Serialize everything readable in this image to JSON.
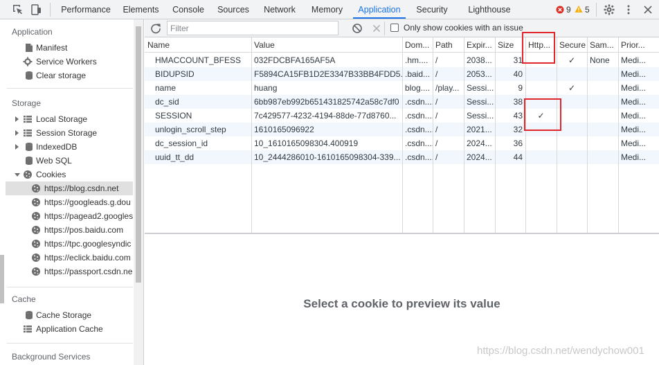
{
  "topbar": {
    "tabs": [
      {
        "label": "Performance",
        "active": false
      },
      {
        "label": "Elements",
        "active": false
      },
      {
        "label": "Console",
        "active": false
      },
      {
        "label": "Sources",
        "active": false
      },
      {
        "label": "Network",
        "active": false
      },
      {
        "label": "Memory",
        "active": false
      },
      {
        "label": "Application",
        "active": true
      },
      {
        "label": "Security",
        "active": false
      },
      {
        "label": "Lighthouse",
        "active": false
      }
    ],
    "error_count": "9",
    "warning_count": "5",
    "icons": [
      "inspect-icon",
      "device-toggle-icon",
      "error-icon",
      "warning-icon",
      "settings-gear-icon",
      "more-vertical-icon",
      "close-icon"
    ]
  },
  "sidebar": {
    "application": {
      "title": "Application",
      "items": [
        {
          "label": "Manifest",
          "icon": "manifest-icon"
        },
        {
          "label": "Service Workers",
          "icon": "gear-icon"
        },
        {
          "label": "Clear storage",
          "icon": "database-icon"
        }
      ]
    },
    "storage": {
      "title": "Storage",
      "items": [
        {
          "label": "Local Storage",
          "icon": "grid-icon",
          "expander": "collapsed"
        },
        {
          "label": "Session Storage",
          "icon": "grid-icon",
          "expander": "collapsed"
        },
        {
          "label": "IndexedDB",
          "icon": "database-icon",
          "expander": "collapsed"
        },
        {
          "label": "Web SQL",
          "icon": "database-icon"
        },
        {
          "label": "Cookies",
          "icon": "cookie-icon",
          "expander": "expanded"
        }
      ],
      "cookie_origins": [
        {
          "label": "https://blog.csdn.net",
          "selected": true
        },
        {
          "label": "https://googleads.g.dou",
          "selected": false
        },
        {
          "label": "https://pagead2.googles",
          "selected": false
        },
        {
          "label": "https://pos.baidu.com",
          "selected": false
        },
        {
          "label": "https://tpc.googlesyndic",
          "selected": false
        },
        {
          "label": "https://eclick.baidu.com",
          "selected": false
        },
        {
          "label": "https://passport.csdn.ne",
          "selected": false
        }
      ]
    },
    "cache": {
      "title": "Cache",
      "items": [
        {
          "label": "Cache Storage",
          "icon": "database-icon"
        },
        {
          "label": "Application Cache",
          "icon": "grid-icon"
        }
      ]
    },
    "background": {
      "title": "Background Services"
    }
  },
  "toolbar": {
    "filter_placeholder": "Filter",
    "only_issue_label": "Only show cookies with an issue",
    "only_issue_checked": false
  },
  "cookies_table": {
    "columns": [
      "Name",
      "Value",
      "Dom...",
      "Path",
      "Expir...",
      "Size",
      "Http...",
      "Secure",
      "Sam...",
      "Prior..."
    ],
    "rows": [
      {
        "name": "HMACCOUNT_BFESS",
        "value": "032FDCBFA165AF5A",
        "domain": ".hm....",
        "path": "/",
        "expires": "2038...",
        "size": "31",
        "http": "",
        "secure": "✓",
        "same": "None",
        "priority": "Medi..."
      },
      {
        "name": "BIDUPSID",
        "value": "F5894CA15FB1D2E3347B33BB4FDD5...",
        "domain": ".baid...",
        "path": "/",
        "expires": "2053...",
        "size": "40",
        "http": "",
        "secure": "",
        "same": "",
        "priority": "Medi..."
      },
      {
        "name": "name",
        "value": "huang",
        "domain": "blog....",
        "path": "/play...",
        "expires": "Sessi...",
        "size": "9",
        "http": "",
        "secure": "✓",
        "same": "",
        "priority": "Medi..."
      },
      {
        "name": "dc_sid",
        "value": "6bb987eb992b651431825742a58c7df0",
        "domain": ".csdn....",
        "path": "/",
        "expires": "Sessi...",
        "size": "38",
        "http": "",
        "secure": "",
        "same": "",
        "priority": "Medi..."
      },
      {
        "name": "SESSION",
        "value": "7c429577-4232-4194-88de-77d8760...",
        "domain": ".csdn....",
        "path": "/",
        "expires": "Sessi...",
        "size": "43",
        "http": "✓",
        "secure": "",
        "same": "",
        "priority": "Medi..."
      },
      {
        "name": "unlogin_scroll_step",
        "value": "1610165096922",
        "domain": ".csdn....",
        "path": "/",
        "expires": "2021...",
        "size": "32",
        "http": "",
        "secure": "",
        "same": "",
        "priority": "Medi..."
      },
      {
        "name": "dc_session_id",
        "value": "10_1610165098304.400919",
        "domain": ".csdn....",
        "path": "/",
        "expires": "2024...",
        "size": "36",
        "http": "",
        "secure": "",
        "same": "",
        "priority": "Medi..."
      },
      {
        "name": "uuid_tt_dd",
        "value": "10_2444286010-1610165098304-339...",
        "domain": ".csdn....",
        "path": "/",
        "expires": "2024...",
        "size": "44",
        "http": "",
        "secure": "",
        "same": "",
        "priority": "Medi..."
      }
    ]
  },
  "preview": {
    "message": "Select a cookie to preview its value"
  },
  "watermark": "https://blog.csdn.net/wendychow001",
  "colors": {
    "accent": "#1a73e8",
    "annotation_red": "#e0262a",
    "row_alt": "#f2f7fd",
    "selected_item": "#e0e0e0"
  }
}
